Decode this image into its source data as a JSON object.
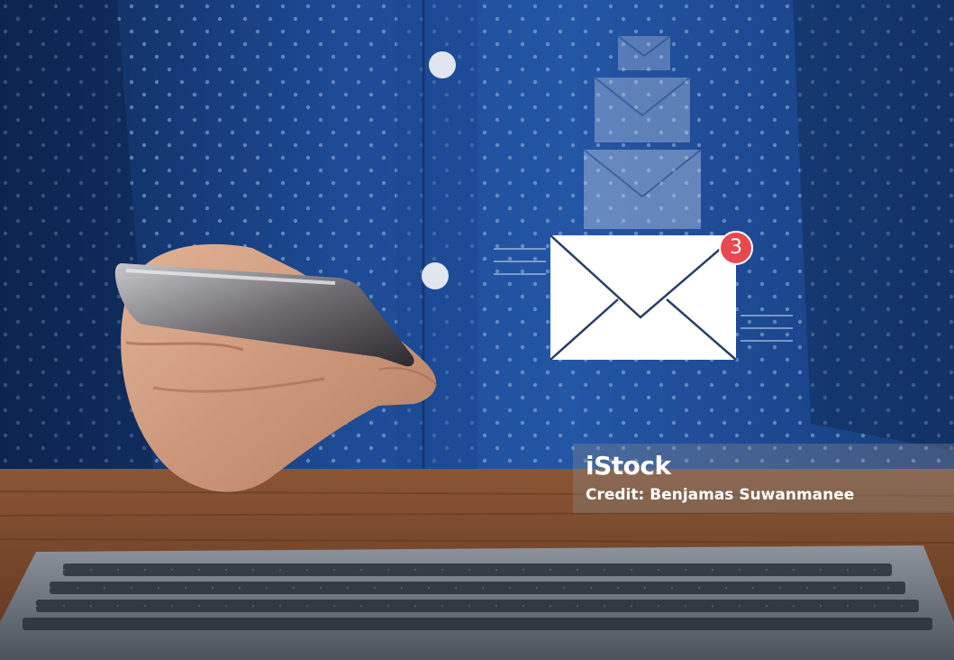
{
  "photo": {
    "subject": "person holding smartphone above laptop keyboard with floating email icons",
    "palette": {
      "shirt": "#1f4f9a",
      "shirt_dark": "#143770",
      "wood": "#7a4a2e",
      "keyboard": "#3d4450",
      "envelope": "#ffffff",
      "badge": "#e8484f"
    }
  },
  "notification": {
    "count": "3",
    "icon": "envelope-icon"
  },
  "watermark": {
    "brand": "iStock",
    "credit": "Credit: Benjamas Suwanmanee"
  }
}
